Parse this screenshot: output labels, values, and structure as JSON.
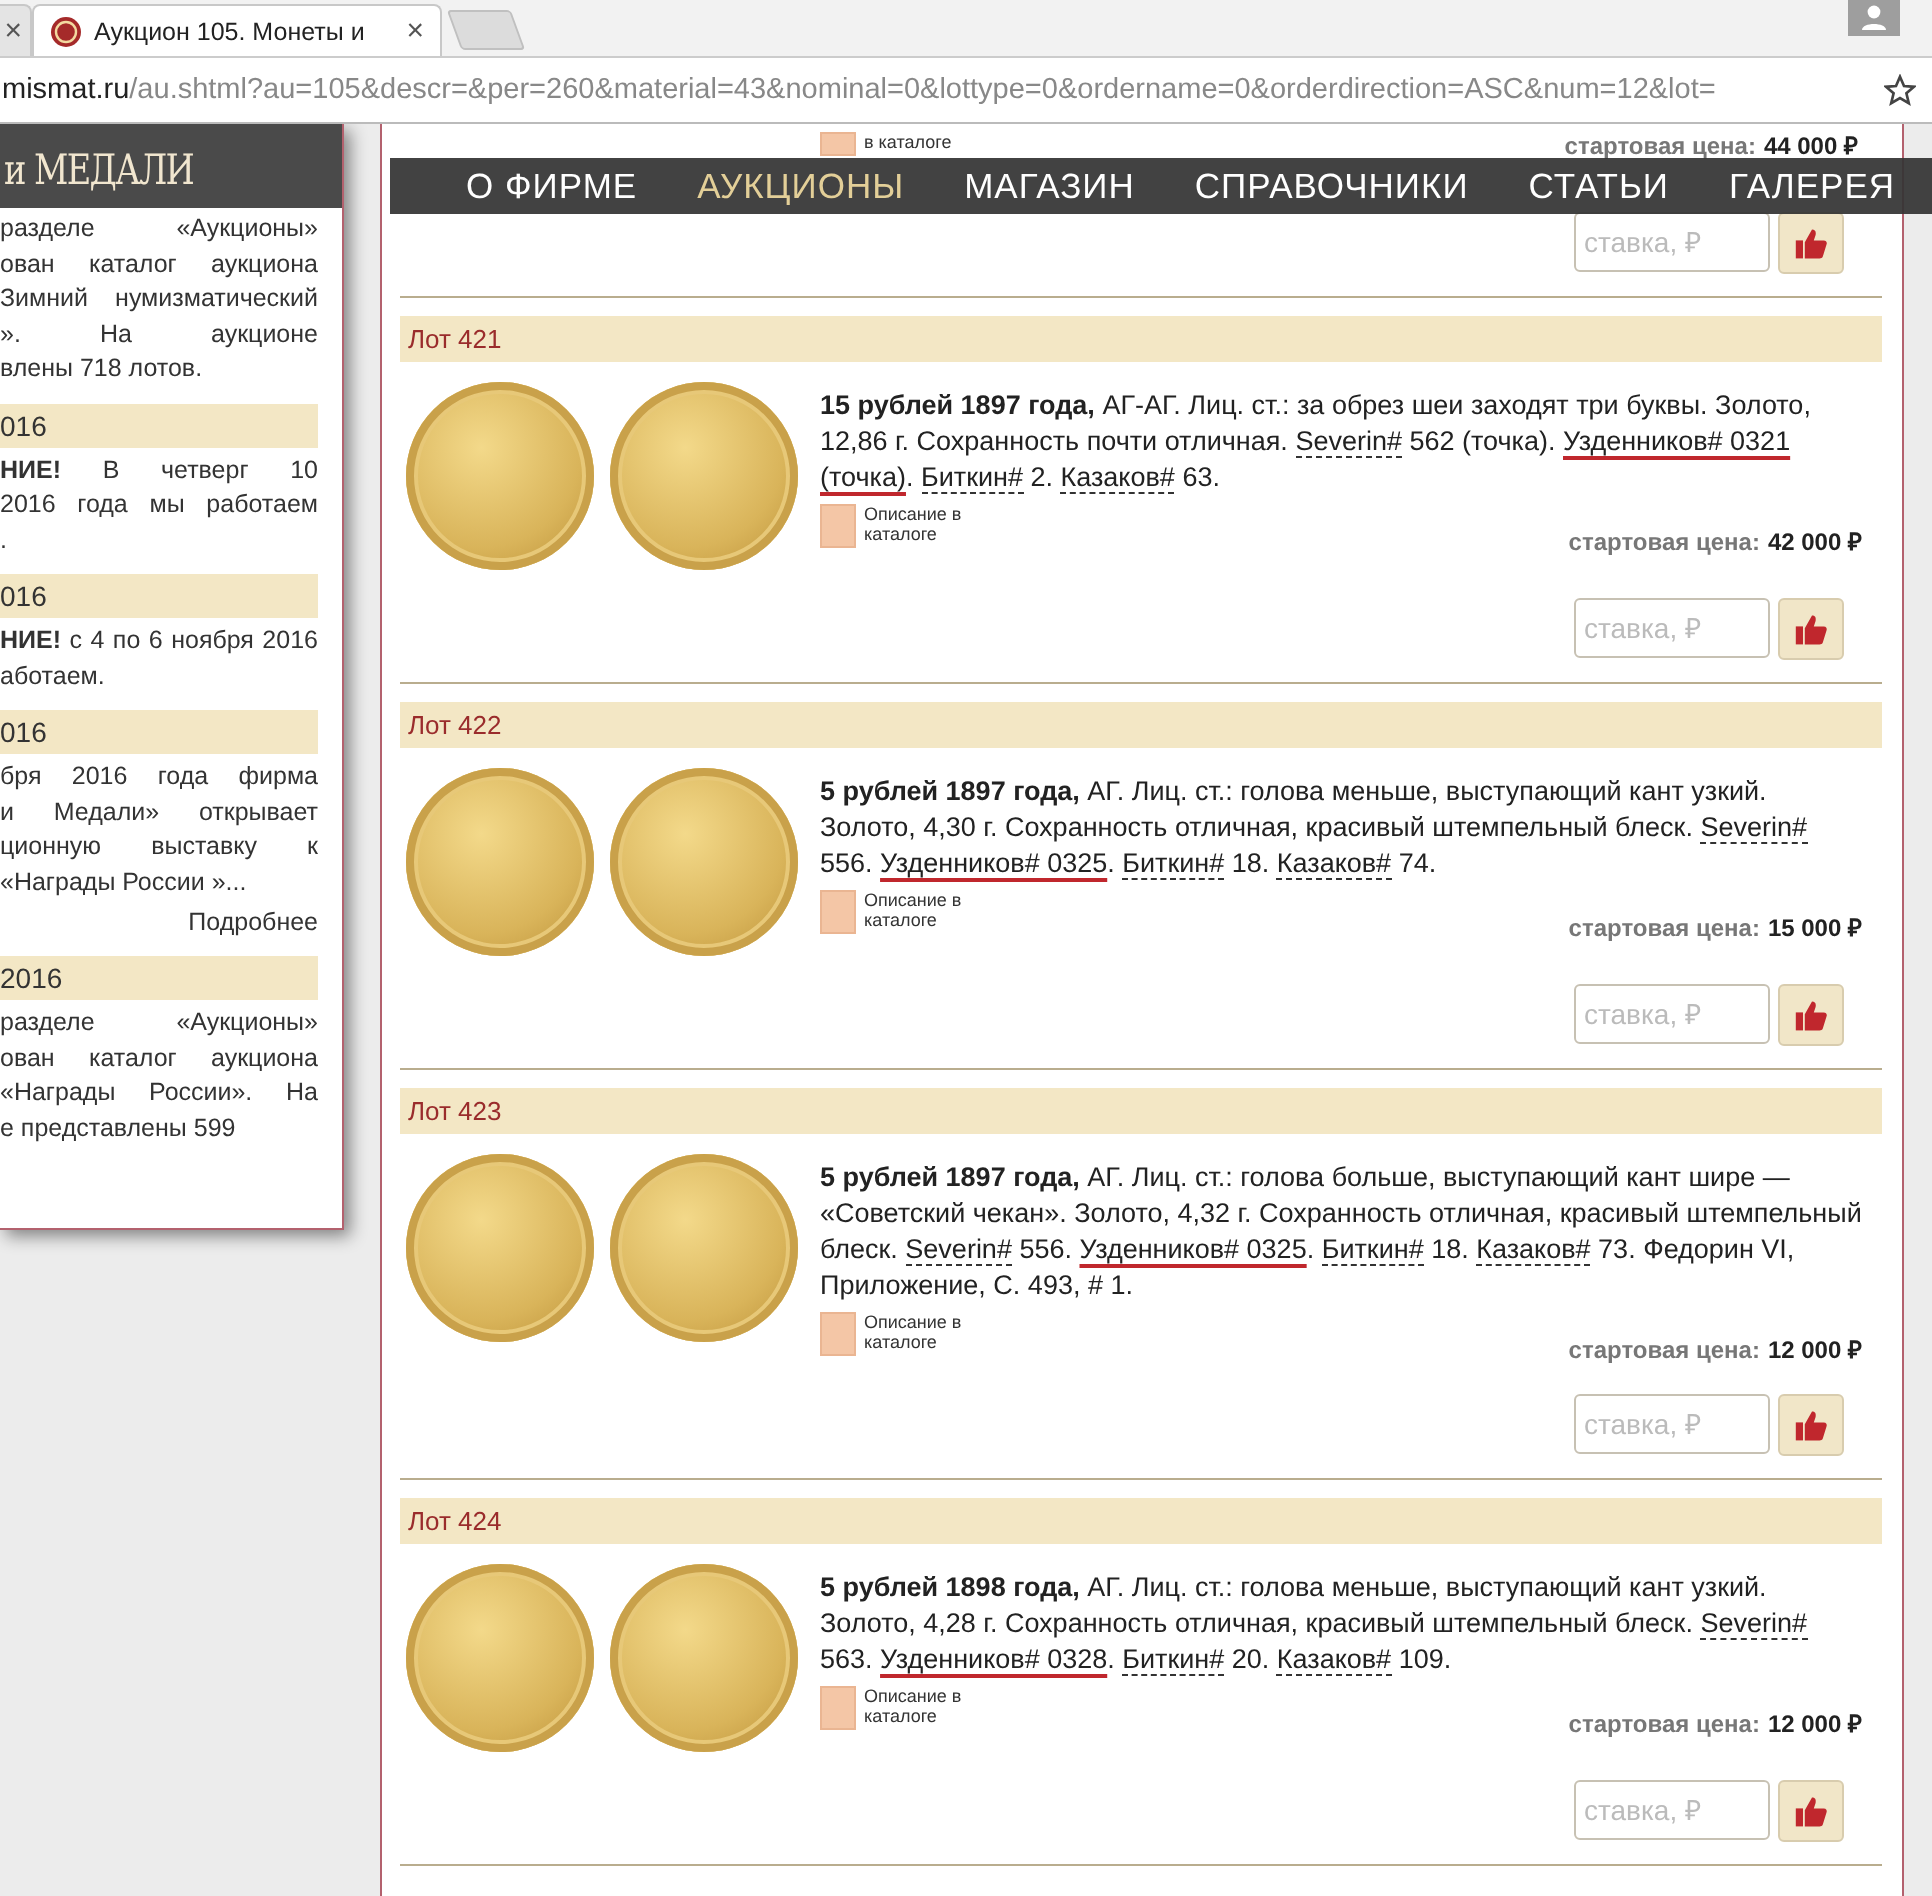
{
  "browser": {
    "tabs": [
      {
        "close": "×",
        "selected": false
      },
      {
        "title": "Аукцион 105. Монеты и",
        "close": "×",
        "selected": true
      }
    ],
    "address": {
      "host": "mismat.ru",
      "path": "/au.shtml?au=105&descr=&per=260&material=43&nominal=0&lottype=0&ordername=0&orderdirection=ASC&num=12&lot="
    }
  },
  "nav": {
    "items": [
      {
        "label": "О ФИРМЕ",
        "selected": false
      },
      {
        "label": "АУКЦИОНЫ",
        "selected": true
      },
      {
        "label": "МАГАЗИН",
        "selected": false
      },
      {
        "label": "СПРАВОЧНИКИ",
        "selected": false
      },
      {
        "label": "СТАТЬИ",
        "selected": false
      },
      {
        "label": "ГАЛЕРЕЯ",
        "selected": false
      }
    ]
  },
  "sidebar": {
    "logo": "и МЕДАЛИ",
    "news": [
      {
        "lines": [
          "разделе «Аукционы»",
          "ован каталог аукциона",
          "Зимний нумизматический",
          "». На аукционе",
          "влены 718 лотов."
        ]
      },
      {
        "date": "016",
        "lines": [
          "**НИЕ!** В четверг 10",
          "2016 года мы работаем",
          "."
        ]
      },
      {
        "date": "016",
        "lines": [
          "**НИЕ!** с 4 по 6 ноября 2016",
          "аботаем."
        ]
      },
      {
        "date": "016",
        "lines": [
          "бря 2016 года фирма",
          "и Медали» открывает",
          "ционную выставку к",
          "«Награды России »..."
        ],
        "more": "Подробнее"
      },
      {
        "date": "2016",
        "lines": [
          "разделе «Аукционы»",
          "ован каталог аукциона",
          "«Награды России». На",
          "е представлены 599"
        ]
      }
    ]
  },
  "lots": [
    {
      "kind": "partial",
      "catalog_note": "в каталоге",
      "price_label": "стартовая цена:",
      "price": "44 000 ₽",
      "bid_placeholder": "ставка, ₽"
    },
    {
      "kind": "full",
      "label": "Лот 421",
      "catalog_note": "Описание в каталоге",
      "price_label": "стартовая цена:",
      "price": "42 000 ₽",
      "bid_placeholder": "ставка, ₽",
      "description": [
        {
          "kind": "title",
          "text": "15 рублей 1897 года,"
        },
        {
          "kind": "plain",
          "text": " АГ-АГ. Лиц. ст.: за обрез шеи заходят три буквы. Золото, 12,86 г. Сохранность почти отличная. "
        },
        {
          "kind": "ref",
          "text": "Severin#"
        },
        {
          "kind": "plain",
          "text": " 562 (точка). "
        },
        {
          "kind": "marked",
          "text": "Узденников# 0321 (точка)"
        },
        {
          "kind": "plain",
          "text": ". "
        },
        {
          "kind": "ref",
          "text": "Биткин#"
        },
        {
          "kind": "plain",
          "text": " 2. "
        },
        {
          "kind": "ref",
          "text": "Казаков#"
        },
        {
          "kind": "plain",
          "text": " 63."
        }
      ]
    },
    {
      "kind": "full",
      "label": "Лот 422",
      "catalog_note": "Описание в каталоге",
      "price_label": "стартовая цена:",
      "price": "15 000 ₽",
      "bid_placeholder": "ставка, ₽",
      "description": [
        {
          "kind": "title",
          "text": "5 рублей 1897 года,"
        },
        {
          "kind": "plain",
          "text": " АГ. Лиц. ст.: голова меньше, выступающий кант узкий. Золото, 4,30 г. Сохранность отличная, красивый штемпельный блеск. "
        },
        {
          "kind": "ref",
          "text": "Severin#"
        },
        {
          "kind": "plain",
          "text": " 556. "
        },
        {
          "kind": "marked",
          "text": "Узденников# 0325"
        },
        {
          "kind": "plain",
          "text": ". "
        },
        {
          "kind": "ref",
          "text": "Биткин#"
        },
        {
          "kind": "plain",
          "text": " 18. "
        },
        {
          "kind": "ref",
          "text": "Казаков#"
        },
        {
          "kind": "plain",
          "text": " 74."
        }
      ]
    },
    {
      "kind": "full",
      "label": "Лот 423",
      "catalog_note": "Описание в каталоге",
      "price_label": "стартовая цена:",
      "price": "12 000 ₽",
      "bid_placeholder": "ставка, ₽",
      "description": [
        {
          "kind": "title",
          "text": "5 рублей 1897 года,"
        },
        {
          "kind": "plain",
          "text": " АГ. Лиц. ст.: голова больше, выступающий кант шире — «Советский чекан». Золото, 4,32 г. Сохранность отличная, красивый штемпельный блеск. "
        },
        {
          "kind": "ref",
          "text": "Severin#"
        },
        {
          "kind": "plain",
          "text": " 556. "
        },
        {
          "kind": "marked",
          "text": "Узденников# 0325"
        },
        {
          "kind": "plain",
          "text": ". "
        },
        {
          "kind": "ref",
          "text": "Биткин#"
        },
        {
          "kind": "plain",
          "text": " 18. "
        },
        {
          "kind": "ref",
          "text": "Казаков#"
        },
        {
          "kind": "plain",
          "text": " 73. Федорин VI, Приложение, С. 493, # 1."
        }
      ]
    },
    {
      "kind": "full",
      "label": "Лот 424",
      "catalog_note": "Описание в каталоге",
      "price_label": "стартовая цена:",
      "price": "12 000 ₽",
      "bid_placeholder": "ставка, ₽",
      "description": [
        {
          "kind": "title",
          "text": "5 рублей 1898 года,"
        },
        {
          "kind": "plain",
          "text": " АГ. Лиц. ст.: голова меньше, выступающий кант узкий. Золото, 4,28 г. Сохранность отличная, красивый штемпельный блеск. "
        },
        {
          "kind": "ref",
          "text": "Severin#"
        },
        {
          "kind": "plain",
          "text": " 563. "
        },
        {
          "kind": "marked",
          "text": "Узденников# 0328"
        },
        {
          "kind": "plain",
          "text": ". "
        },
        {
          "kind": "ref",
          "text": "Биткин#"
        },
        {
          "kind": "plain",
          "text": " 20. "
        },
        {
          "kind": "ref",
          "text": "Казаков#"
        },
        {
          "kind": "plain",
          "text": " 109."
        }
      ]
    }
  ]
}
